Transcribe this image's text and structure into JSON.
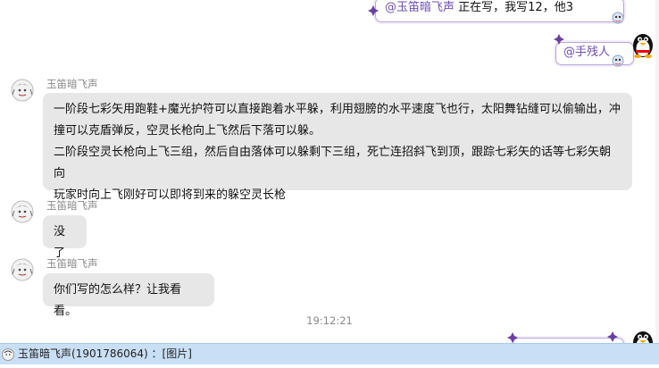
{
  "messages": {
    "sent_top": {
      "mention": "@玉笛暗飞声",
      "text": "正在写，我写12，他3"
    },
    "sent_mid": {
      "mention": "@手残人"
    },
    "recv1": {
      "sender": "玉笛暗飞声",
      "lines": [
        "一阶段七彩矢用跑鞋+魔光护符可以直接跑着水平躲，利用翅膀的水平速度飞也行，太阳舞钻缝可以偷输出，冲",
        "撞可以克盾弹反，空灵长枪向上飞然后下落可以躲。",
        "二阶段空灵长枪向上飞三组，然后自由落体可以躲剩下三组，死亡连招斜飞到顶，跟踪七彩矢的话等七彩矢朝向",
        "玩家时向上飞刚好可以即将到来的躲空灵长枪"
      ]
    },
    "recv2": {
      "sender": "玉笛暗飞声",
      "text": "没了"
    },
    "recv3": {
      "sender": "玉笛暗飞声",
      "text": "你们写的怎么样？让我看看。"
    },
    "timestamp": "19:12:21"
  },
  "status_bar": {
    "text": "玉笛暗飞声(1901786064) ：[图片]"
  },
  "colors": {
    "received_bubble": "#e7e7e7",
    "mention": "#6f4fb0",
    "status_bar": "#c9dff5"
  }
}
